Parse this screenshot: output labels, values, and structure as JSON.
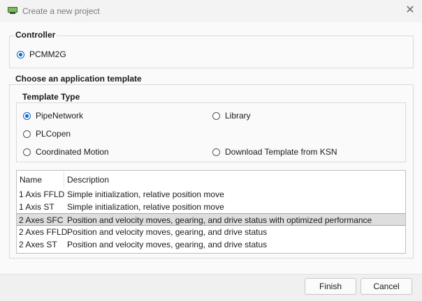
{
  "window": {
    "title": "Create a new project",
    "close_icon": "close-icon"
  },
  "controller": {
    "heading": "Controller",
    "option": "PCMM2G",
    "selected": true
  },
  "template": {
    "heading": "Choose an application template",
    "type_heading": "Template Type",
    "types": {
      "pipenetwork": {
        "label": "PipeNetwork",
        "selected": true
      },
      "library": {
        "label": "Library",
        "selected": false
      },
      "plcopen": {
        "label": "PLCopen",
        "selected": false
      },
      "coordinated": {
        "label": "Coordinated Motion",
        "selected": false
      },
      "download": {
        "label": "Download Template from KSN",
        "selected": false
      }
    }
  },
  "table": {
    "columns": {
      "name": "Name",
      "description": "Description"
    },
    "rows": [
      {
        "name": "1 Axis FFLD",
        "description": "Simple initialization, relative position move"
      },
      {
        "name": "1 Axis ST",
        "description": "Simple initialization, relative position move"
      },
      {
        "name": "2 Axes SFC",
        "description": "Position and velocity moves, gearing, and drive status with optimized performance",
        "selected": true
      },
      {
        "name": "2 Axes FFLD",
        "description": "Position and velocity moves, gearing, and drive status"
      },
      {
        "name": "2 Axes ST",
        "description": "Position and velocity moves, gearing, and drive status"
      }
    ]
  },
  "buttons": {
    "finish": "Finish",
    "cancel": "Cancel"
  }
}
